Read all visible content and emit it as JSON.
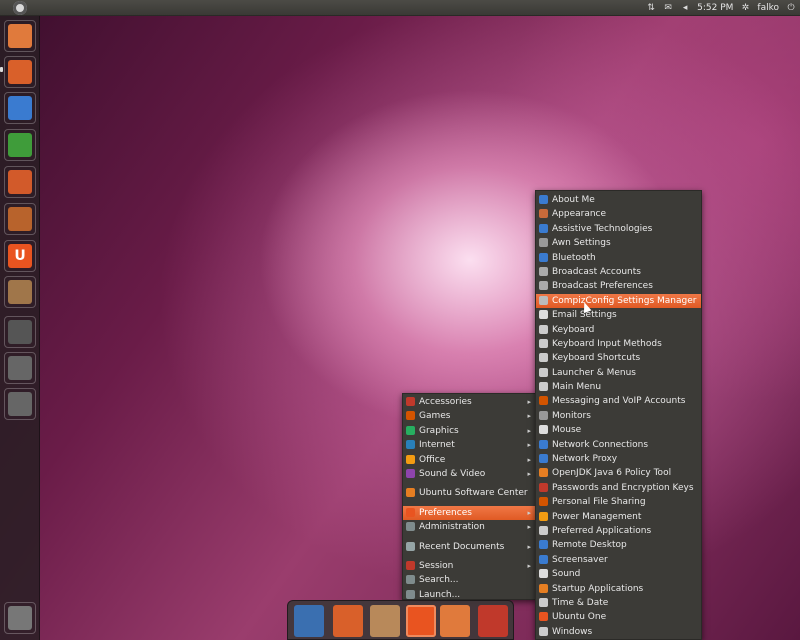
{
  "topbar": {
    "time": "5:52 PM",
    "user": "falko",
    "icons": [
      "ubuntu-logo-icon",
      "network-icon",
      "mail-icon",
      "volume-icon",
      "user-icon",
      "power-icon"
    ]
  },
  "launcher": {
    "items": [
      {
        "name": "home-folder",
        "color": "#e07a3c"
      },
      {
        "name": "firefox",
        "color": "#d9602a"
      },
      {
        "name": "libreoffice-writer",
        "color": "#3a7bd0"
      },
      {
        "name": "libreoffice-calc",
        "color": "#3f9c3a"
      },
      {
        "name": "libreoffice-impress",
        "color": "#d25a2a"
      },
      {
        "name": "software-center",
        "color": "#b8632c"
      },
      {
        "name": "ubuntu-one",
        "color": "#e95420",
        "glyph": "U"
      },
      {
        "name": "archive-manager",
        "color": "#a0764a"
      },
      {
        "name": "workspace-switcher",
        "color": "#555555"
      },
      {
        "name": "applications-lens",
        "color": "#666666"
      },
      {
        "name": "files-lens",
        "color": "#666666"
      }
    ],
    "trash": "trash-icon"
  },
  "main_menu": {
    "items": [
      {
        "label": "Accessories",
        "submenu": true
      },
      {
        "label": "Games",
        "submenu": true
      },
      {
        "label": "Graphics",
        "submenu": true
      },
      {
        "label": "Internet",
        "submenu": true
      },
      {
        "label": "Office",
        "submenu": true
      },
      {
        "label": "Sound & Video",
        "submenu": true
      },
      {
        "label": "Ubuntu Software Center",
        "submenu": false
      },
      {
        "label": "Preferences",
        "submenu": true,
        "selected": true
      },
      {
        "label": "Administration",
        "submenu": true
      },
      {
        "label": "Recent Documents",
        "submenu": true
      },
      {
        "label": "Session",
        "submenu": true
      },
      {
        "label": "Search...",
        "submenu": false
      },
      {
        "label": "Launch...",
        "submenu": false
      }
    ]
  },
  "preferences_menu": {
    "items": [
      "About Me",
      "Appearance",
      "Assistive Technologies",
      "Awn Settings",
      "Bluetooth",
      "Broadcast Accounts",
      "Broadcast Preferences",
      "CompizConfig Settings Manager",
      "Email Settings",
      "Keyboard",
      "Keyboard Input Methods",
      "Keyboard Shortcuts",
      "Launcher & Menus",
      "Main Menu",
      "Messaging and VoIP Accounts",
      "Monitors",
      "Mouse",
      "Network Connections",
      "Network Proxy",
      "OpenJDK Java 6 Policy Tool",
      "Passwords and Encryption Keys",
      "Personal File Sharing",
      "Power Management",
      "Preferred Applications",
      "Remote Desktop",
      "Screensaver",
      "Sound",
      "Startup Applications",
      "Time & Date",
      "Ubuntu One",
      "Windows"
    ],
    "selected_index": 7
  },
  "dock": {
    "items": [
      "save-manager",
      "firefox",
      "package-installer",
      "ubuntu-menu",
      "folder",
      "shutdown"
    ]
  },
  "colors": {
    "accent": "#e95420",
    "menu_bg": "#3c3b37"
  }
}
